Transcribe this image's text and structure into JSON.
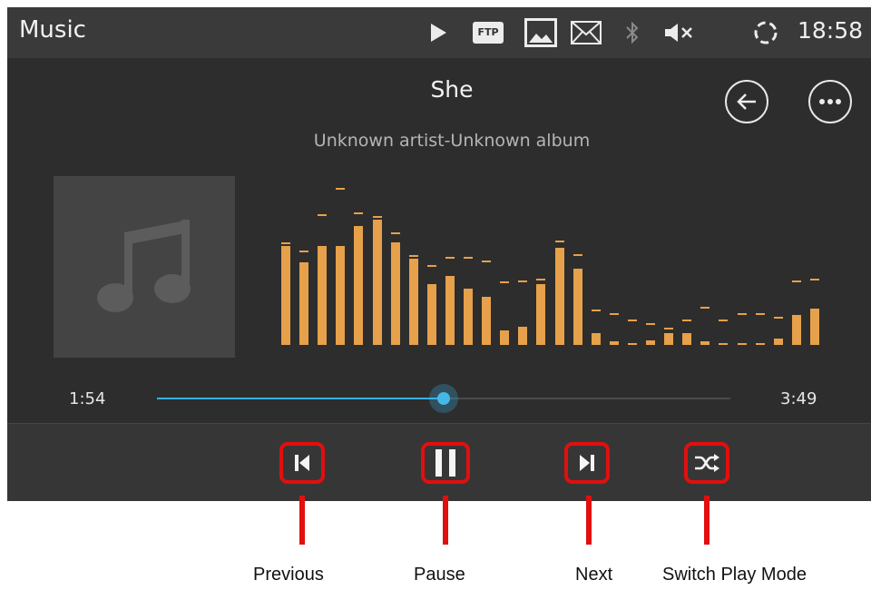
{
  "status_bar": {
    "app_title": "Music",
    "ftp_label": "FTP",
    "time": "18:58",
    "icons": [
      "play-icon",
      "ftp-icon",
      "image-icon",
      "mail-icon",
      "bluetooth-icon",
      "mute-icon",
      "sync-icon"
    ]
  },
  "player": {
    "title": "She",
    "subtitle": "Unknown artist-Unknown album",
    "current_time": "1:54",
    "total_time": "3:49",
    "progress": 0.5,
    "album_art_icon": "music-note-icon",
    "spectrum": [
      0.6,
      0.5,
      0.6,
      0.6,
      0.72,
      0.76,
      0.62,
      0.52,
      0.37,
      0.42,
      0.34,
      0.29,
      0.09,
      0.11,
      0.37,
      0.59,
      0.46,
      0.07,
      0.02,
      0.01,
      0.03,
      0.07,
      0.07,
      0.02,
      0.01,
      0.01,
      0.01,
      0.04,
      0.18,
      0.22
    ],
    "peaks": [
      0.6,
      0.55,
      0.77,
      0.93,
      0.78,
      0.76,
      0.66,
      0.52,
      0.46,
      0.51,
      0.51,
      0.49,
      0.36,
      0.37,
      0.38,
      0.61,
      0.53,
      0.19,
      0.17,
      0.13,
      0.11,
      0.08,
      0.13,
      0.21,
      0.13,
      0.17,
      0.17,
      0.15,
      0.37,
      0.38
    ]
  },
  "header_buttons": {
    "back_icon": "back-arrow-icon",
    "more_icon": "more-options-icon"
  },
  "controls": {
    "previous_icon": "previous-icon",
    "pause_icon": "pause-icon",
    "next_icon": "next-icon",
    "shuffle_icon": "shuffle-icon"
  },
  "annotations": {
    "previous": "Previous",
    "pause": "Pause",
    "next": "Next",
    "switch_play_mode": "Switch Play Mode"
  },
  "colors": {
    "accent": "#3bb0e3",
    "spectrum": "#e6a14a",
    "highlight": "#e10f0f"
  }
}
